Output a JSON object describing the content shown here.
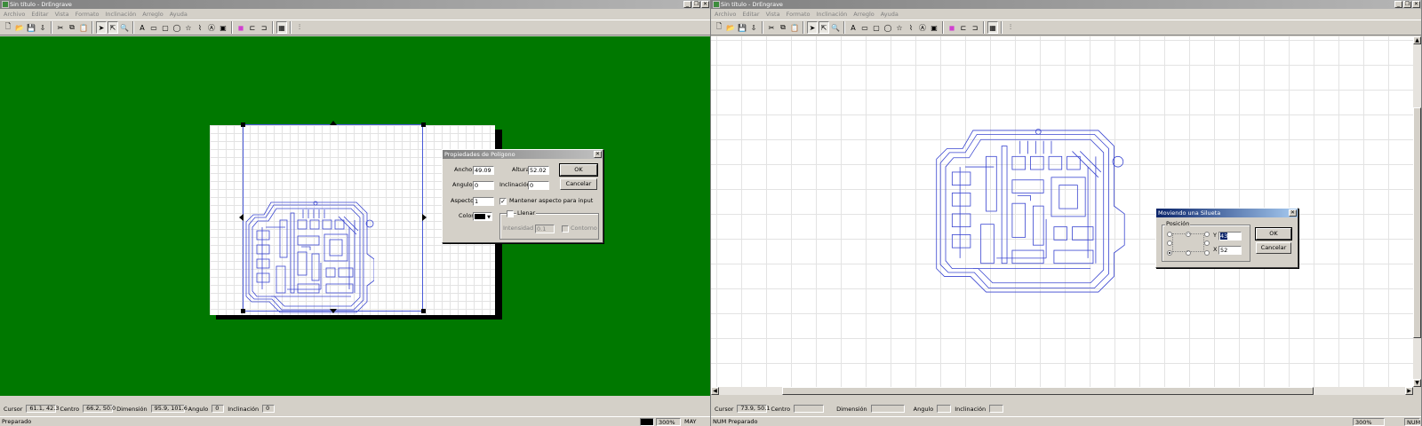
{
  "left_window": {
    "title": "Sin título - DrEngrave",
    "controls": [
      "_",
      "❐",
      "✕"
    ],
    "menu": [
      "Archivo",
      "Editar",
      "Vista",
      "Formato",
      "Inclinación",
      "Arreglo",
      "Ayuda"
    ],
    "status": {
      "cursor_label": "Cursor",
      "cursor_value": "61.1, 42.3",
      "center_label": "Centro",
      "center_value": "66.2, 50.0",
      "dimension_label": "Dimensión",
      "dimension_value": "95.9, 101.6",
      "angle_label": "Angulo",
      "angle_value": "0",
      "inclination_label": "Inclinación",
      "inclination_value": "0"
    },
    "statusbar": {
      "message": "Preparado"
    },
    "dialog": {
      "title": "Propiedades de Polígono",
      "width_label": "Ancho",
      "width_value": "49.09",
      "height_label": "Altura",
      "height_value": "52.02",
      "angle_label": "Angulo",
      "angle_value": "0",
      "inclination_label": "Inclinación",
      "inclination_value": "0",
      "aspect_label": "Aspecto",
      "aspect_value": "1",
      "keep_aspect_label": "Mantener aspecto para input",
      "keep_aspect_checked": true,
      "color_label": "Color",
      "color_value": "#000000",
      "fill_label": "Llenar",
      "fill_checked": false,
      "intensity_label": "Intensidad",
      "intensity_value": "0.1",
      "contour_label": "Contorno",
      "ok_label": "OK",
      "cancel_label": "Cancelar"
    }
  },
  "right_window": {
    "title": "Sin título - DrEngrave",
    "controls": [
      "_",
      "❐",
      "✕"
    ],
    "menu": [
      "Archivo",
      "Editar",
      "Vista",
      "Formato",
      "Inclinación",
      "Arreglo",
      "Ayuda"
    ],
    "status": {
      "cursor_label": "Cursor",
      "cursor_value": "73.9, 50.1",
      "center_label": "Centro",
      "center_value": "",
      "dimension_label": "Dimensión",
      "dimension_value": "",
      "angle_label": "Angulo",
      "angle_value": "",
      "inclination_label": "Inclinación",
      "inclination_value": ""
    },
    "statusbar": {
      "zoom_left": "300%",
      "caps": "MAY",
      "num_left": "NUM Preparado",
      "zoom_right": "300%",
      "num_right": "NUM"
    },
    "dialog": {
      "title": "Moviendo una Silueta",
      "position_label": "Posición",
      "y_label": "Y",
      "y_value": "43",
      "x_label": "X",
      "x_value": "52",
      "ok_label": "OK",
      "cancel_label": "Cancelar"
    }
  },
  "toolbar_icons": [
    "new-icon",
    "open-icon",
    "save-icon",
    "import-icon",
    "cut-icon",
    "copy-icon",
    "paste-icon",
    "select-icon",
    "node-edit-icon",
    "zoom-icon",
    "text-icon",
    "rectangle-icon",
    "rounded-rect-icon",
    "ellipse-icon",
    "star-icon",
    "polyline-icon",
    "text-frame-icon",
    "group-icon",
    "color-icon",
    "align-left-icon",
    "align-right-icon",
    "grid-icon",
    "tools-icon"
  ],
  "colors": {
    "workspace_green": "#007800",
    "pcb_trace": "#3a46d0",
    "selection": "#4a5ad8"
  }
}
